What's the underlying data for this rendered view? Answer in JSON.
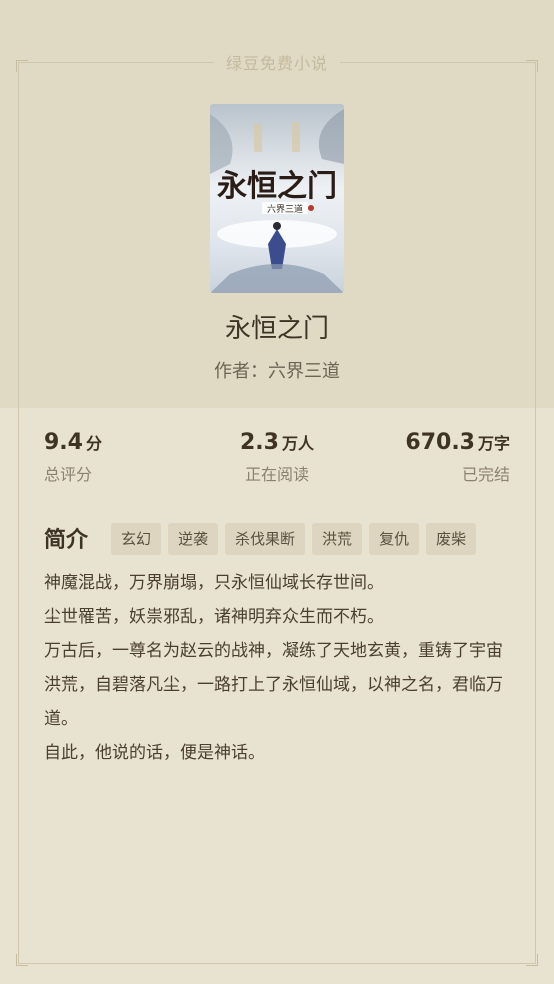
{
  "brand": "绿豆免费小说",
  "book": {
    "title": "永恒之门",
    "author_line": "作者：六界三道",
    "cover_title": "永恒之门",
    "cover_author": "六界三道"
  },
  "stats": [
    {
      "value": "9.4",
      "unit": "分",
      "label": "总评分"
    },
    {
      "value": "2.3",
      "unit": "万人",
      "label": "正在阅读"
    },
    {
      "value": "670.3",
      "unit": "万字",
      "label": "已完结"
    }
  ],
  "intro": {
    "heading": "简介",
    "tags": [
      "玄幻",
      "逆袭",
      "杀伐果断",
      "洪荒",
      "复仇",
      "废柴"
    ],
    "paragraphs": [
      "神魔混战，万界崩塌，只永恒仙域长存世间。",
      "尘世罹苦，妖祟邪乱，诸神明弃众生而不朽。",
      "万古后，一尊名为赵云的战神，凝练了天地玄黄，重铸了宇宙洪荒，自碧落凡尘，一路打上了永恒仙域，以神之名，君临万道。",
      "自此，他说的话，便是神话。"
    ]
  },
  "colors": {
    "background": "#e5dfcc",
    "text": "#3e3325",
    "muted": "#8c8270",
    "tag_bg": "#ddd5bf"
  }
}
